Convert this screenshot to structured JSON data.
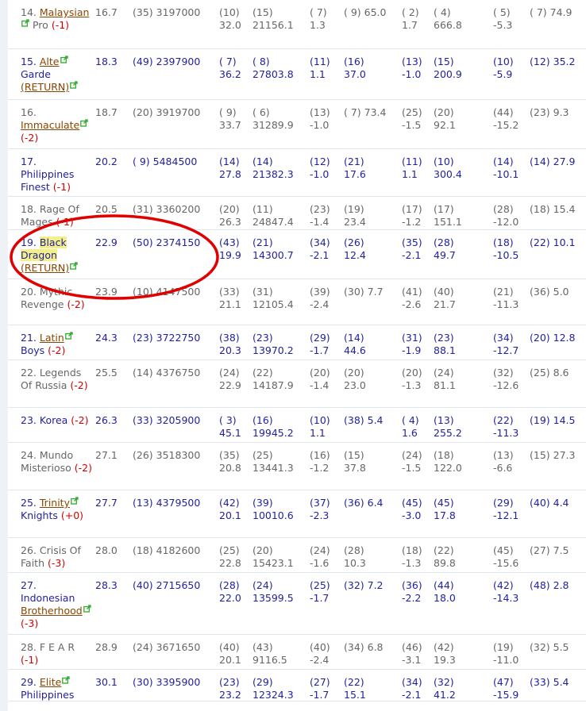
{
  "colors": {
    "gray_text": "#666666",
    "blue_text": "#1f1fa0",
    "red_change": "#d40000",
    "link_brown": "#8b4500",
    "highlight": "#f5ef8a",
    "annotation_red": "#e00000",
    "ext_icon": "#2faa2f"
  },
  "icons": {
    "external_link": "external-link-icon"
  },
  "rows": [
    {
      "rank": "14.",
      "team": [
        "Malaysian",
        " Pro"
      ],
      "link": "Malaysian",
      "change": "(-1)",
      "tone": "gray",
      "c1": "16.7",
      "c2": "(35) 3197000",
      "c3": [
        "(10)",
        "32.0"
      ],
      "c4": [
        "(15)",
        "21156.1"
      ],
      "c5": [
        "( 7)",
        "1.3"
      ],
      "c6": [
        "( 9) 65.0",
        ""
      ],
      "c7": [
        "( 2)",
        "1.7"
      ],
      "c8": [
        "( 4)",
        "666.8"
      ],
      "c9": [
        "( 5)",
        "-5.3"
      ],
      "c10": "( 7) 74.9",
      "h": 62
    },
    {
      "rank": "15.",
      "team": [
        "Alte",
        "Garde"
      ],
      "link": "Alte",
      "change": "(RETURN)",
      "tone": "blue",
      "c1": "18.3",
      "c2": "(49) 2397900",
      "c3": [
        "( 7)",
        "36.2"
      ],
      "c4": [
        "( 8)",
        "27803.8"
      ],
      "c5": [
        "(11)",
        "1.1"
      ],
      "c6": [
        "(16)",
        "37.0"
      ],
      "c7": [
        "(13)",
        "-1.0"
      ],
      "c8": [
        "(15)",
        "200.9"
      ],
      "c9": [
        "(10)",
        "-5.9"
      ],
      "c10": "(12) 35.2",
      "h": 64
    },
    {
      "rank": "16.",
      "team": [
        "Immaculate",
        ""
      ],
      "link": "Immaculate",
      "change": "(-2)",
      "tone": "gray",
      "c1": "18.7",
      "c2": "(20) 3919700",
      "c3": [
        "( 9)",
        "33.7"
      ],
      "c4": [
        "( 6)",
        "31289.9"
      ],
      "c5": [
        "(13)",
        "-1.0"
      ],
      "c6": [
        "( 7) 73.4",
        ""
      ],
      "c7": [
        "(25)",
        "-1.5"
      ],
      "c8": [
        "(20)",
        "92.1"
      ],
      "c9": [
        "(44)",
        "-15.2"
      ],
      "c10": "(23) 9.3",
      "h": 62
    },
    {
      "rank": "17.",
      "team": [
        "Philippines",
        "Finest"
      ],
      "link": "",
      "change": "(-1)",
      "tone": "blue",
      "c1": "20.2",
      "c2": "( 9) 5484500",
      "c3": [
        "(14)",
        "27.8"
      ],
      "c4": [
        "(14)",
        "21382.3"
      ],
      "c5": [
        "(12)",
        "-1.0"
      ],
      "c6": [
        "(21)",
        "17.6"
      ],
      "c7": [
        "(11)",
        "1.1"
      ],
      "c8": [
        "(10)",
        "300.4"
      ],
      "c9": [
        "(14)",
        "-10.1"
      ],
      "c10": "(14) 27.9",
      "h": 60
    },
    {
      "rank": "18.",
      "team": [
        "Rage Of",
        "Mages"
      ],
      "link": "",
      "change": "(-1)",
      "tone": "gray",
      "c1": "20.5",
      "c2": "(31) 3360200",
      "c3": [
        "(20)",
        "26.3"
      ],
      "c4": [
        "(11)",
        "24847.4"
      ],
      "c5": [
        "(23)",
        "-1.4"
      ],
      "c6": [
        "(19)",
        "23.4"
      ],
      "c7": [
        "(17)",
        "-1.2"
      ],
      "c8": [
        "(17)",
        "151.1"
      ],
      "c9": [
        "(28)",
        "-12.0"
      ],
      "c10": "(18) 15.4",
      "h": 42
    },
    {
      "rank": "19.",
      "team": [
        "Black",
        "Dragon"
      ],
      "link": "",
      "change": "(RETURN)",
      "tone": "blue",
      "highlight": true,
      "c1": "22.9",
      "c2": "(50) 2374150",
      "c3": [
        "(43)",
        "19.9"
      ],
      "c4": [
        "(21)",
        "14300.7"
      ],
      "c5": [
        "(34)",
        "-2.1"
      ],
      "c6": [
        "(26)",
        "12.4"
      ],
      "c7": [
        "(35)",
        "-2.1"
      ],
      "c8": [
        "(28)",
        "49.7"
      ],
      "c9": [
        "(18)",
        "-10.5"
      ],
      "c10": "(22) 10.1",
      "h": 62
    },
    {
      "rank": "20.",
      "team": [
        "Mythic",
        "Revenge"
      ],
      "link": "",
      "change": "(-2)",
      "tone": "gray",
      "c1": "23.9",
      "c2": "(10) 4147500",
      "c3": [
        "(33)",
        "21.1"
      ],
      "c4": [
        "(31)",
        "12105.4"
      ],
      "c5": [
        "(39)",
        "-2.4"
      ],
      "c6": [
        "(30) 7.7",
        ""
      ],
      "c7": [
        "(41)",
        "-2.6"
      ],
      "c8": [
        "(40)",
        "21.7"
      ],
      "c9": [
        "(21)",
        "-11.3"
      ],
      "c10": "(36) 5.0",
      "h": 58
    },
    {
      "rank": "21.",
      "team": [
        "Latin",
        "Boys"
      ],
      "link": "Latin",
      "change": "(-2)",
      "tone": "blue",
      "c1": "24.3",
      "c2": "(23) 3722750",
      "c3": [
        "(38)",
        "20.3"
      ],
      "c4": [
        "(23)",
        "13970.2"
      ],
      "c5": [
        "(29)",
        "-1.7"
      ],
      "c6": [
        "(14)",
        "44.6"
      ],
      "c7": [
        "(31)",
        "-1.9"
      ],
      "c8": [
        "(23)",
        "88.1"
      ],
      "c9": [
        "(34)",
        "-12.7"
      ],
      "c10": "(20) 12.8",
      "h": 44
    },
    {
      "rank": "22.",
      "team": [
        "Legends",
        "Of Russia"
      ],
      "link": "",
      "change": "(-2)",
      "tone": "gray",
      "c1": "25.5",
      "c2": "(14) 4376750",
      "c3": [
        "(24)",
        "22.9"
      ],
      "c4": [
        "(22)",
        "14187.9"
      ],
      "c5": [
        "(20)",
        "-1.4"
      ],
      "c6": [
        "(20)",
        "23.0"
      ],
      "c7": [
        "(20)",
        "-1.3"
      ],
      "c8": [
        "(24)",
        "81.1"
      ],
      "c9": [
        "(32)",
        "-12.6"
      ],
      "c10": "(25) 8.6",
      "h": 60
    },
    {
      "rank": "23.",
      "team": [
        "Korea",
        ""
      ],
      "link": "",
      "change": "(-2)",
      "tone": "blue",
      "c1": "26.3",
      "c2": "(33) 3205900",
      "c3": [
        "( 3)",
        "45.1"
      ],
      "c4": [
        "(16)",
        "19945.2"
      ],
      "c5": [
        "(10)",
        "1.1"
      ],
      "c6": [
        "(38) 5.4",
        ""
      ],
      "c7": [
        "( 4)",
        "1.6"
      ],
      "c8": [
        "(13)",
        "255.2"
      ],
      "c9": [
        "(22)",
        "-11.3"
      ],
      "c10": "(19) 14.5",
      "h": 44
    },
    {
      "rank": "24.",
      "team": [
        "Mundo",
        "Misterioso"
      ],
      "link": "",
      "change": "(-2)",
      "tone": "gray",
      "c1": "27.1",
      "c2": "(26) 3518300",
      "c3": [
        "(35)",
        "20.8"
      ],
      "c4": [
        "(25)",
        "13441.3"
      ],
      "c5": [
        "(16)",
        "-1.2"
      ],
      "c6": [
        "(15)",
        "37.8"
      ],
      "c7": [
        "(24)",
        "-1.5"
      ],
      "c8": [
        "(18)",
        "122.0"
      ],
      "c9": [
        "(13)",
        "-6.6"
      ],
      "c10": "(15) 27.3",
      "h": 60
    },
    {
      "rank": "25.",
      "team": [
        "Trinity",
        "Knights"
      ],
      "link": "Trinity",
      "change": "(+0)",
      "tone": "blue",
      "c1": "27.7",
      "c2": "(13) 4379500",
      "c3": [
        "(42)",
        "20.1"
      ],
      "c4": [
        "(39)",
        "10010.6"
      ],
      "c5": [
        "(37)",
        "-2.3"
      ],
      "c6": [
        "(36) 6.4",
        ""
      ],
      "c7": [
        "(45)",
        "-3.0"
      ],
      "c8": [
        "(45)",
        "17.8"
      ],
      "c9": [
        "(29)",
        "-12.1"
      ],
      "c10": "(40) 4.4",
      "h": 60
    },
    {
      "rank": "26.",
      "team": [
        "Crisis Of",
        "Faith"
      ],
      "link": "",
      "change": "(-3)",
      "tone": "gray",
      "c1": "28.0",
      "c2": "(18) 4182600",
      "c3": [
        "(25)",
        "22.8"
      ],
      "c4": [
        "(20)",
        "15423.1"
      ],
      "c5": [
        "(24)",
        "-1.6"
      ],
      "c6": [
        "(28)",
        "10.3"
      ],
      "c7": [
        "(18)",
        "-1.3"
      ],
      "c8": [
        "(22)",
        "89.8"
      ],
      "c9": [
        "(45)",
        "-15.6"
      ],
      "c10": "(27) 7.5",
      "h": 44
    },
    {
      "rank": "27.",
      "team": [
        "Indonesian",
        "Brotherhood"
      ],
      "link": "Brotherhood",
      "change": "(-3)",
      "tone": "blue",
      "c1": "28.3",
      "c2": "(40) 2715650",
      "c3": [
        "(28)",
        "22.0"
      ],
      "c4": [
        "(24)",
        "13599.5"
      ],
      "c5": [
        "(25)",
        "-1.7"
      ],
      "c6": [
        "(32) 7.2",
        ""
      ],
      "c7": [
        "(36)",
        "-2.2"
      ],
      "c8": [
        "(44)",
        "18.0"
      ],
      "c9": [
        "(42)",
        "-14.3"
      ],
      "c10": "(48) 2.8",
      "h": 78
    },
    {
      "rank": "28.",
      "team": [
        "F E A R",
        ""
      ],
      "link": "",
      "change": "(-1)",
      "tone": "gray",
      "c1": "28.9",
      "c2": "(24) 3671650",
      "c3": [
        "(40)",
        "20.1"
      ],
      "c4": [
        "(43)",
        "9116.5"
      ],
      "c5": [
        "(40)",
        "-2.4"
      ],
      "c6": [
        "(34) 6.8",
        ""
      ],
      "c7": [
        "(46)",
        "-3.1"
      ],
      "c8": [
        "(42)",
        "19.3"
      ],
      "c9": [
        "(19)",
        "-11.0"
      ],
      "c10": "(32) 5.5",
      "h": 44
    },
    {
      "rank": "29.",
      "team": [
        "Elite",
        "Philippines"
      ],
      "link": "Elite",
      "change": "",
      "tone": "blue",
      "c1": "30.1",
      "c2": "(30) 3395900",
      "c3": [
        "(23)",
        "23.2"
      ],
      "c4": [
        "(29)",
        "12324.3"
      ],
      "c5": [
        "(27)",
        "-1.7"
      ],
      "c6": [
        "(22)",
        "15.1"
      ],
      "c7": [
        "(34)",
        "-2.1"
      ],
      "c8": [
        "(32)",
        "41.2"
      ],
      "c9": [
        "(47)",
        "-15.9"
      ],
      "c10": "(33) 5.4",
      "h": 40
    }
  ]
}
